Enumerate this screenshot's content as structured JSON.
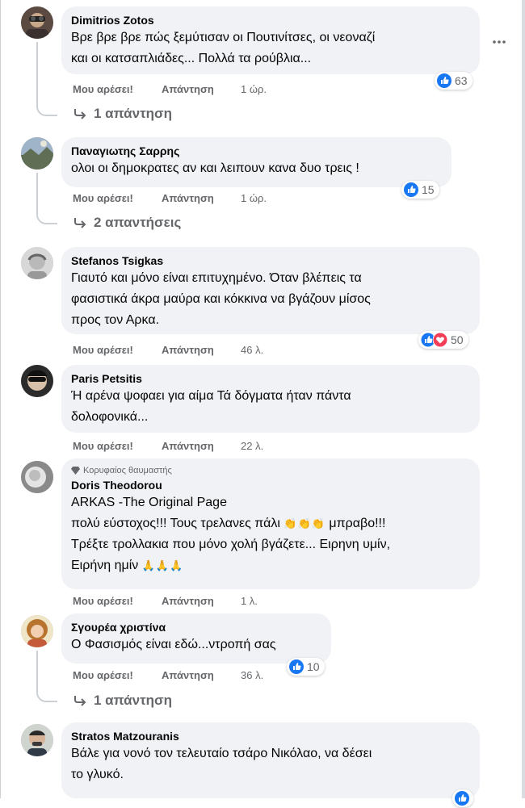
{
  "actions": {
    "like": "Μου αρέσει!",
    "reply": "Απάντηση"
  },
  "comments": [
    {
      "author": "Dimitrios Zotos",
      "lines": [
        "Βρε βρε βρε πώς ξεμύτισαν οι Πουτινίτσες, οι νεοναζί",
        "και οι κατσαπλιάδες... Πολλά τα ρούβλια..."
      ],
      "time": "1 ώρ.",
      "reactions": "63",
      "replies": "1 απάντηση"
    },
    {
      "author": "Παναγιωτης Σαρρης",
      "lines": [
        "ολοι οι δημοκρατες αν και λειπουν κανα δυο τρεις !"
      ],
      "time": "1 ώρ.",
      "reactions": "15",
      "replies": "2 απαντήσεις"
    },
    {
      "author": "Stefanos Tsigkas",
      "lines": [
        "Γιαυτό και μόνο είναι επιτυχημένο. Όταν βλέπεις τα",
        "φασιστικά άκρα μαύρα και κόκκινα να βγάζουν μίσος",
        "προς τον Αρκα."
      ],
      "time": "46 λ.",
      "reactions": "50"
    },
    {
      "author": "Paris Petsitis",
      "lines": [
        "Ή αρένα ψοφαει για αίμα Τά δόγματα ήταν πάντα",
        "δολοφονικά..."
      ],
      "time": "22 λ."
    },
    {
      "badge": "Κορυφαίος θαυμαστής",
      "author": "Doris Theodorou",
      "lines": [
        "ARKAS -The Original Page",
        "πολύ εύστοχος!!! Τους τρελανες πάλι",
        "Τρέξτε τρολλακια που μόνο χολή βγάζετε... Ειρηνη υμίν,",
        "Ειρήνη ημίν"
      ],
      "emoji_clap": "👏👏👏",
      "line2_tail": "μπραβο!!!",
      "emoji_pray": "🙏🙏🙏",
      "time": "1 λ."
    },
    {
      "author": "Σγουρέα χριστίνα",
      "lines": [
        "Ο Φασισμός είναι εδώ...ντροπή σας"
      ],
      "time": "36 λ.",
      "reactions": "10",
      "replies": "1 απάντηση"
    },
    {
      "author": "Stratos Matzouranis",
      "lines": [
        "Βάλε για νονό τον τελευταίο τσάρο Νικόλαο, να δέσει",
        "το γλυκό."
      ]
    }
  ],
  "icons": {
    "like": "like-icon",
    "love": "love-icon",
    "more": "more-icon",
    "reply_arrow": "reply-arrow-icon",
    "badge": "diamond-icon"
  },
  "colors": {
    "like_blue": "#1877f2",
    "love_red": "#f33e58",
    "bubble": "#f0f2f5",
    "meta": "#65676b"
  }
}
